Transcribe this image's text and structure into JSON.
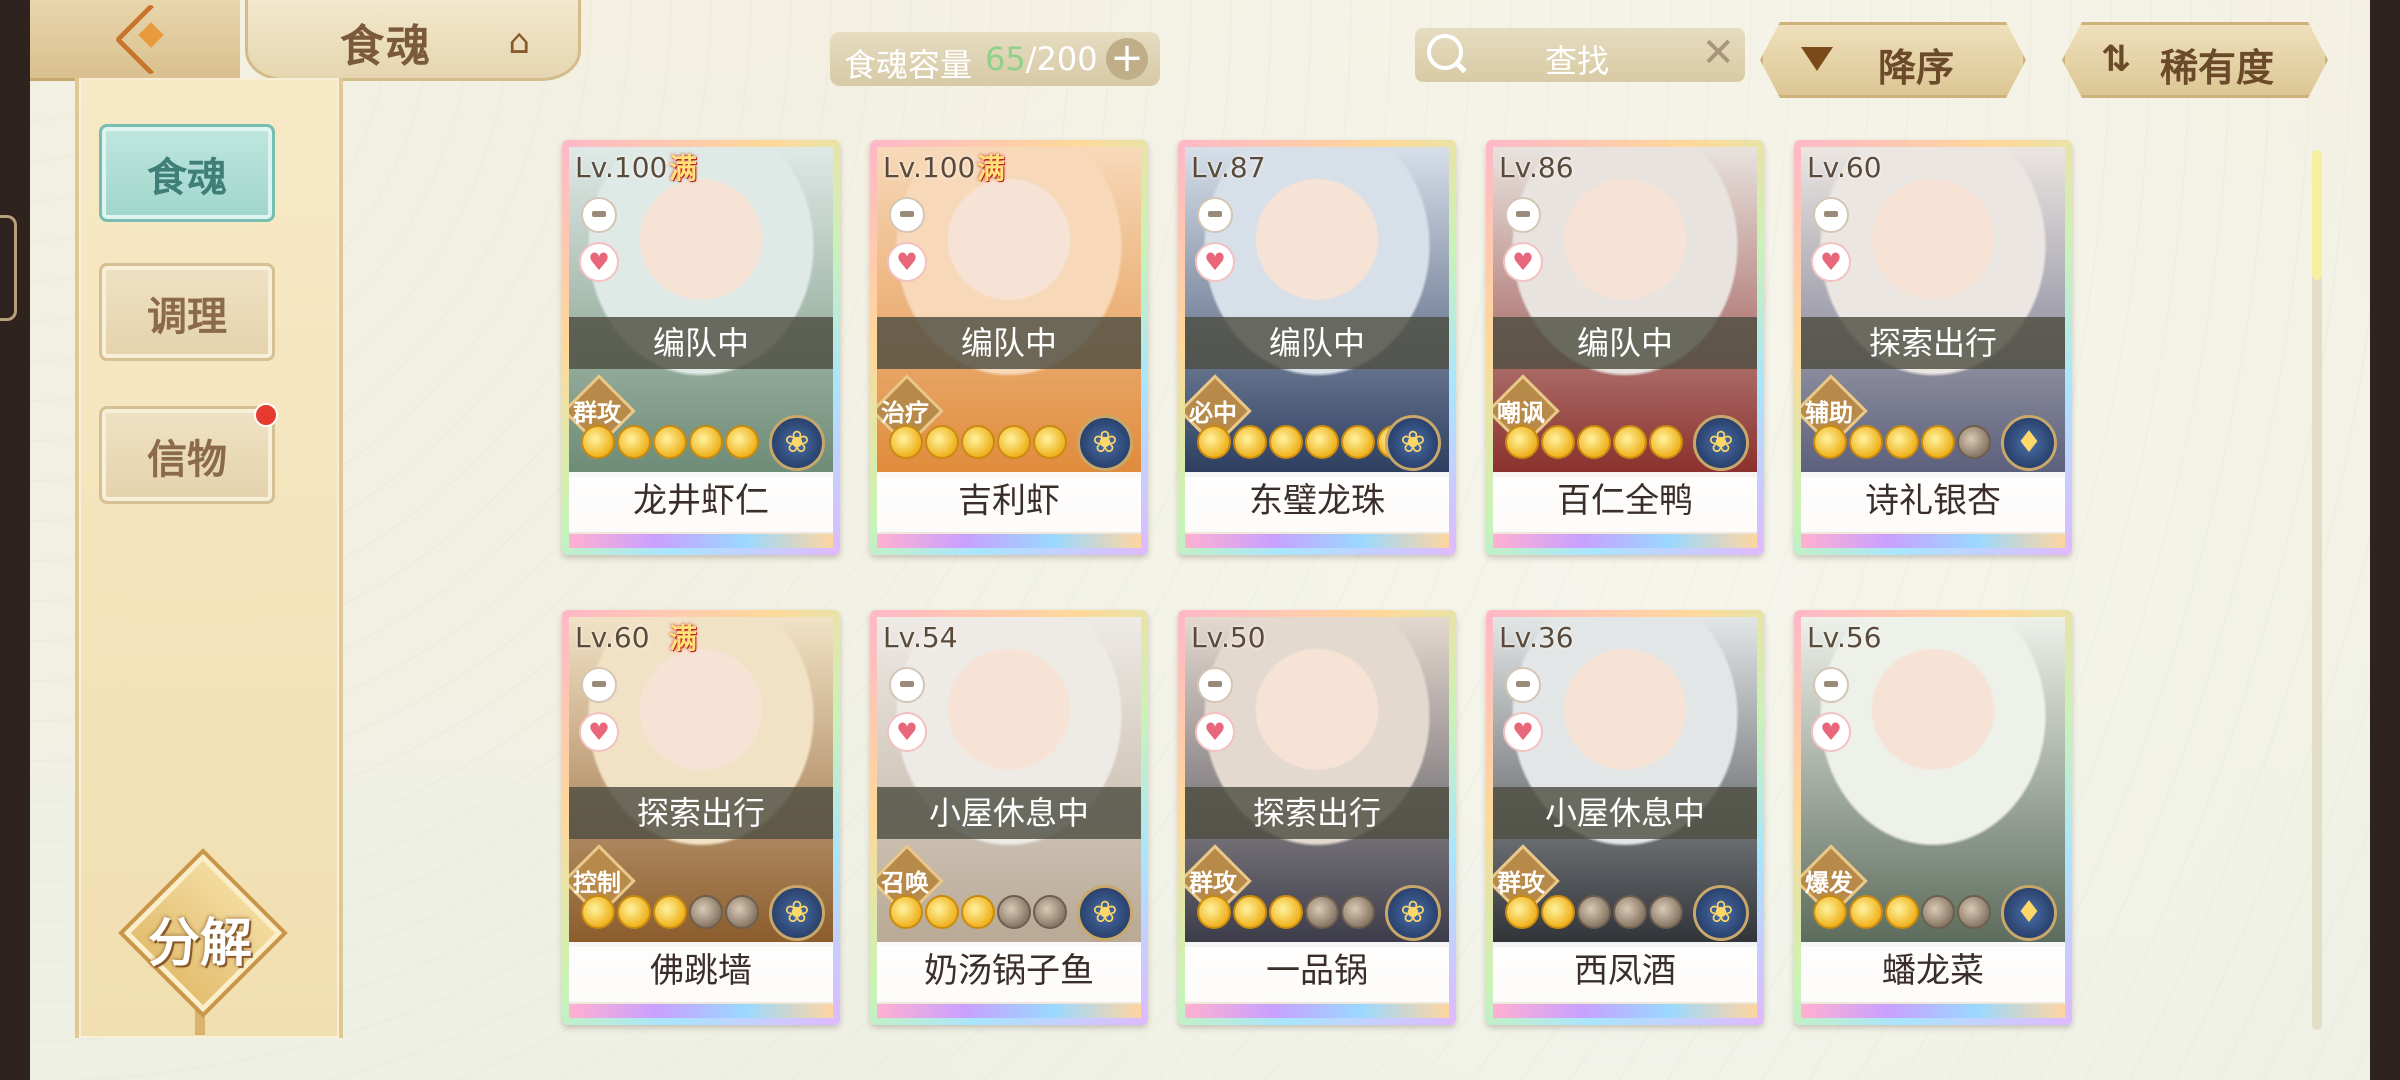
{
  "header": {
    "title": "食魂",
    "capacity_label": "食魂容量",
    "capacity_current": "65",
    "capacity_total": "/200",
    "capacity_plus": "+",
    "search_placeholder": "查找",
    "search_clear": "✕",
    "sort_order_label": "降序",
    "sort_key_label": "稀有度",
    "sort_key_icon": "⇅"
  },
  "sidebar": {
    "items": [
      {
        "label": "食魂",
        "active": true
      },
      {
        "label": "调理",
        "active": false
      },
      {
        "label": "信物",
        "active": false,
        "badge": true
      }
    ],
    "decompose_label": "分解"
  },
  "cards": [
    {
      "level": "Lv.100",
      "full": "满",
      "status": "编队中",
      "role": "群攻",
      "stars_on": 5,
      "stars_total": 5,
      "element_icon": "❀",
      "name": "龙井虾仁",
      "palette": [
        "#dfe9e6",
        "#6b8a74"
      ]
    },
    {
      "level": "Lv.100",
      "full": "满",
      "status": "编队中",
      "role": "治疗",
      "stars_on": 5,
      "stars_total": 5,
      "element_icon": "❀",
      "name": "吉利虾",
      "palette": [
        "#f7d9b9",
        "#e08a3a"
      ]
    },
    {
      "level": "Lv.87",
      "full": "",
      "status": "编队中",
      "role": "必中",
      "stars_on": 6,
      "stars_total": 6,
      "element_icon": "❀",
      "name": "东璧龙珠",
      "palette": [
        "#d7dfe9",
        "#2b3c5e"
      ]
    },
    {
      "level": "Lv.86",
      "full": "",
      "status": "编队中",
      "role": "嘲讽",
      "stars_on": 5,
      "stars_total": 5,
      "element_icon": "❀",
      "name": "百仁全鸭",
      "palette": [
        "#e8e3df",
        "#8a2e2a"
      ]
    },
    {
      "level": "Lv.60",
      "full": "",
      "status": "探索出行",
      "role": "辅助",
      "stars_on": 4,
      "stars_total": 5,
      "element_icon": "♦",
      "name": "诗礼银杏",
      "palette": [
        "#ece6e2",
        "#5a5e7a"
      ]
    },
    {
      "level": "Lv.60",
      "full": "满",
      "status": "探索出行",
      "role": "控制",
      "stars_on": 3,
      "stars_total": 5,
      "element_icon": "❀",
      "name": "佛跳墙",
      "palette": [
        "#f1e2c6",
        "#8a5a2a"
      ]
    },
    {
      "level": "Lv.54",
      "full": "",
      "status": "小屋休息中",
      "role": "召唤",
      "stars_on": 3,
      "stars_total": 5,
      "element_icon": "❀",
      "name": "奶汤锅子鱼",
      "palette": [
        "#eeeae6",
        "#b8a894"
      ]
    },
    {
      "level": "Lv.50",
      "full": "",
      "status": "探索出行",
      "role": "群攻",
      "stars_on": 3,
      "stars_total": 5,
      "element_icon": "❀",
      "name": "一品锅",
      "palette": [
        "#e4d9cf",
        "#3a3a48"
      ]
    },
    {
      "level": "Lv.36",
      "full": "",
      "status": "小屋休息中",
      "role": "群攻",
      "stars_on": 2,
      "stars_total": 5,
      "element_icon": "❀",
      "name": "西凤酒",
      "palette": [
        "#e3e6e6",
        "#2e3136"
      ]
    },
    {
      "level": "Lv.56",
      "full": "",
      "status": "",
      "role": "爆发",
      "stars_on": 3,
      "stars_total": 5,
      "element_icon": "♦",
      "name": "蟠龙菜",
      "palette": [
        "#eef0ea",
        "#5a6a5a"
      ]
    }
  ],
  "colors": {
    "accent_teal": "#9fd6cc",
    "gold": "#e2bd6e",
    "badge_red": "#e63a2e",
    "capacity_green": "#8fd18a"
  }
}
